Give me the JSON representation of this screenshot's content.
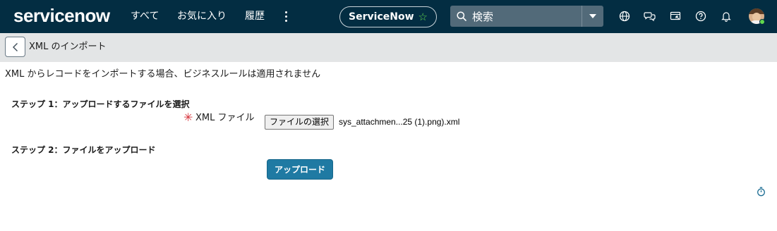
{
  "header": {
    "logo": "servicenow",
    "nav": [
      "すべて",
      "お気に入り",
      "履歴"
    ],
    "more_icon": "more-vertical-icon",
    "app_pill": "ServiceNow",
    "search_placeholder": "検索",
    "icons": [
      "globe-icon",
      "chat-icon",
      "screen-icon",
      "help-icon",
      "bell-icon"
    ],
    "avatar": "avatar",
    "colors": {
      "nav_bg": "#032d42",
      "star": "#62d84e",
      "search_bg": "#526a79"
    }
  },
  "form": {
    "title": "XML のインポート",
    "notice": "XML からレコードをインポートする場合、ビジネスルールは適用されません",
    "step1": "ステップ 1：アップロードするファイルを選択",
    "required_mark": "✳",
    "field_label": "XML ファイル",
    "choose_button": "ファイルの選択",
    "file_name": "sys_attachmen...25 (1).png).xml",
    "step2": "ステップ 2：ファイルをアップロード",
    "upload_button": "アップロード",
    "colors": {
      "upload_bg": "#1f7aa3",
      "required": "#d6323a"
    }
  }
}
